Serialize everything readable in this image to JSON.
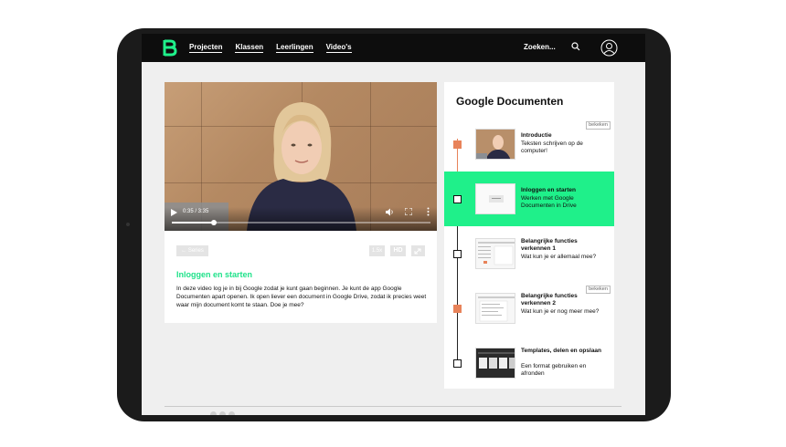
{
  "brand": {
    "accent": "#1ff08a",
    "accent_text": "#1fe28a",
    "timeline_done": "#e8835a",
    "topbar": "#0d0d0d"
  },
  "header": {
    "nav": [
      "Projecten",
      "Klassen",
      "Leerlingen",
      "Video's"
    ],
    "search_label": "Zoeken...",
    "icons": [
      "logo-b",
      "search-icon",
      "user-icon"
    ]
  },
  "player": {
    "time": "0:35 / 3:35",
    "progress_fraction": 0.163,
    "icons": [
      "play-icon",
      "volume-icon",
      "fullscreen-icon",
      "more-icon"
    ]
  },
  "lesson": {
    "series_label": "← Series",
    "speed_label": "1.5x",
    "hd_label": "HD",
    "title": "Inloggen en starten",
    "description": "In deze video log je in bij Google zodat je kunt gaan beginnen. Je kunt de app Google Documenten apart openen. Ik open liever een document in Google Drive, zodat ik precies weet waar mijn document komt te staan. Doe je mee?"
  },
  "series": {
    "title": "Google Documenten",
    "items": [
      {
        "title": "Introductie",
        "subtitle": "Teksten schrijven op de computer!",
        "badge": "bekeken",
        "state": "done"
      },
      {
        "title": "Inloggen en starten",
        "subtitle": "Werken met Google Documenten in Drive",
        "badge": "",
        "state": "active"
      },
      {
        "title": "Belangrijke functies verkennen 1",
        "subtitle": "Wat kun je er allemaal mee?",
        "badge": "",
        "state": "todo"
      },
      {
        "title": "Belangrijke functies verkennen 2",
        "subtitle": "Wat kun je er nog meer mee?",
        "badge": "bekeken",
        "state": "done"
      },
      {
        "title": "Templates, delen en opslaan",
        "subtitle": "Een format gebruiken en afronden",
        "badge": "",
        "state": "todo"
      }
    ]
  }
}
